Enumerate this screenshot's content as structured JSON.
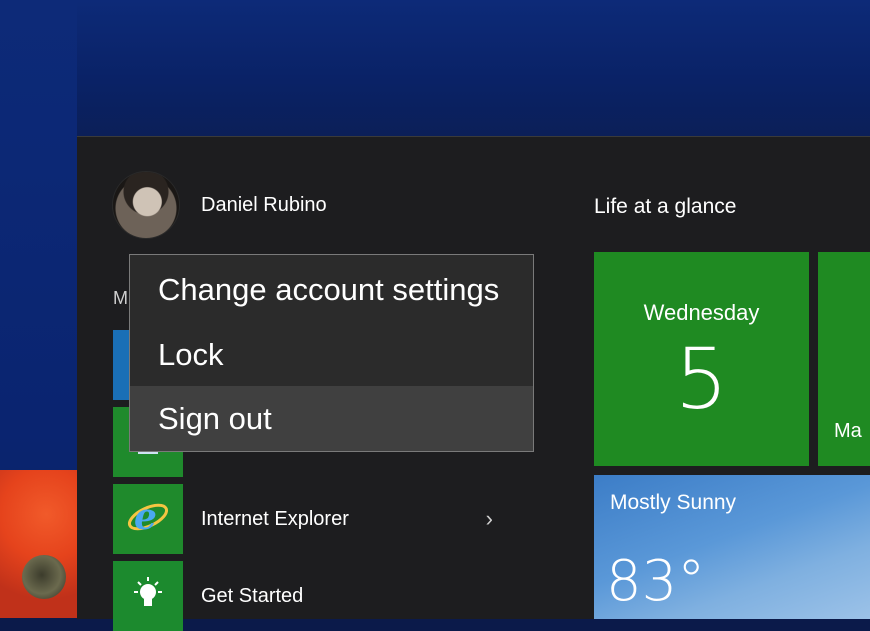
{
  "user": {
    "name": "Daniel Rubino"
  },
  "apps": {
    "section_letter": "M",
    "items": [
      {
        "label": "",
        "icon": "ie-blue-icon",
        "color": "#1a6fb6"
      },
      {
        "label": "",
        "icon": "app-green-icon",
        "color": "#1f8a2c"
      },
      {
        "label": "Internet Explorer",
        "icon": "internet-explorer-icon",
        "color": "#1f8a2c",
        "has_submenu": true
      },
      {
        "label": "Get Started",
        "icon": "lightbulb-icon",
        "color": "#1c8a2e"
      }
    ]
  },
  "context_menu": {
    "items": [
      {
        "label": "Change account settings"
      },
      {
        "label": "Lock"
      },
      {
        "label": "Sign out",
        "highlighted": true
      }
    ]
  },
  "tiles": {
    "group_title": "Life at a glance",
    "calendar": {
      "day": "Wednesday",
      "date": "5",
      "color": "#1f8a22"
    },
    "mail": {
      "label": "Ma"
    },
    "weather": {
      "condition": "Mostly Sunny",
      "temperature": "83°"
    }
  }
}
